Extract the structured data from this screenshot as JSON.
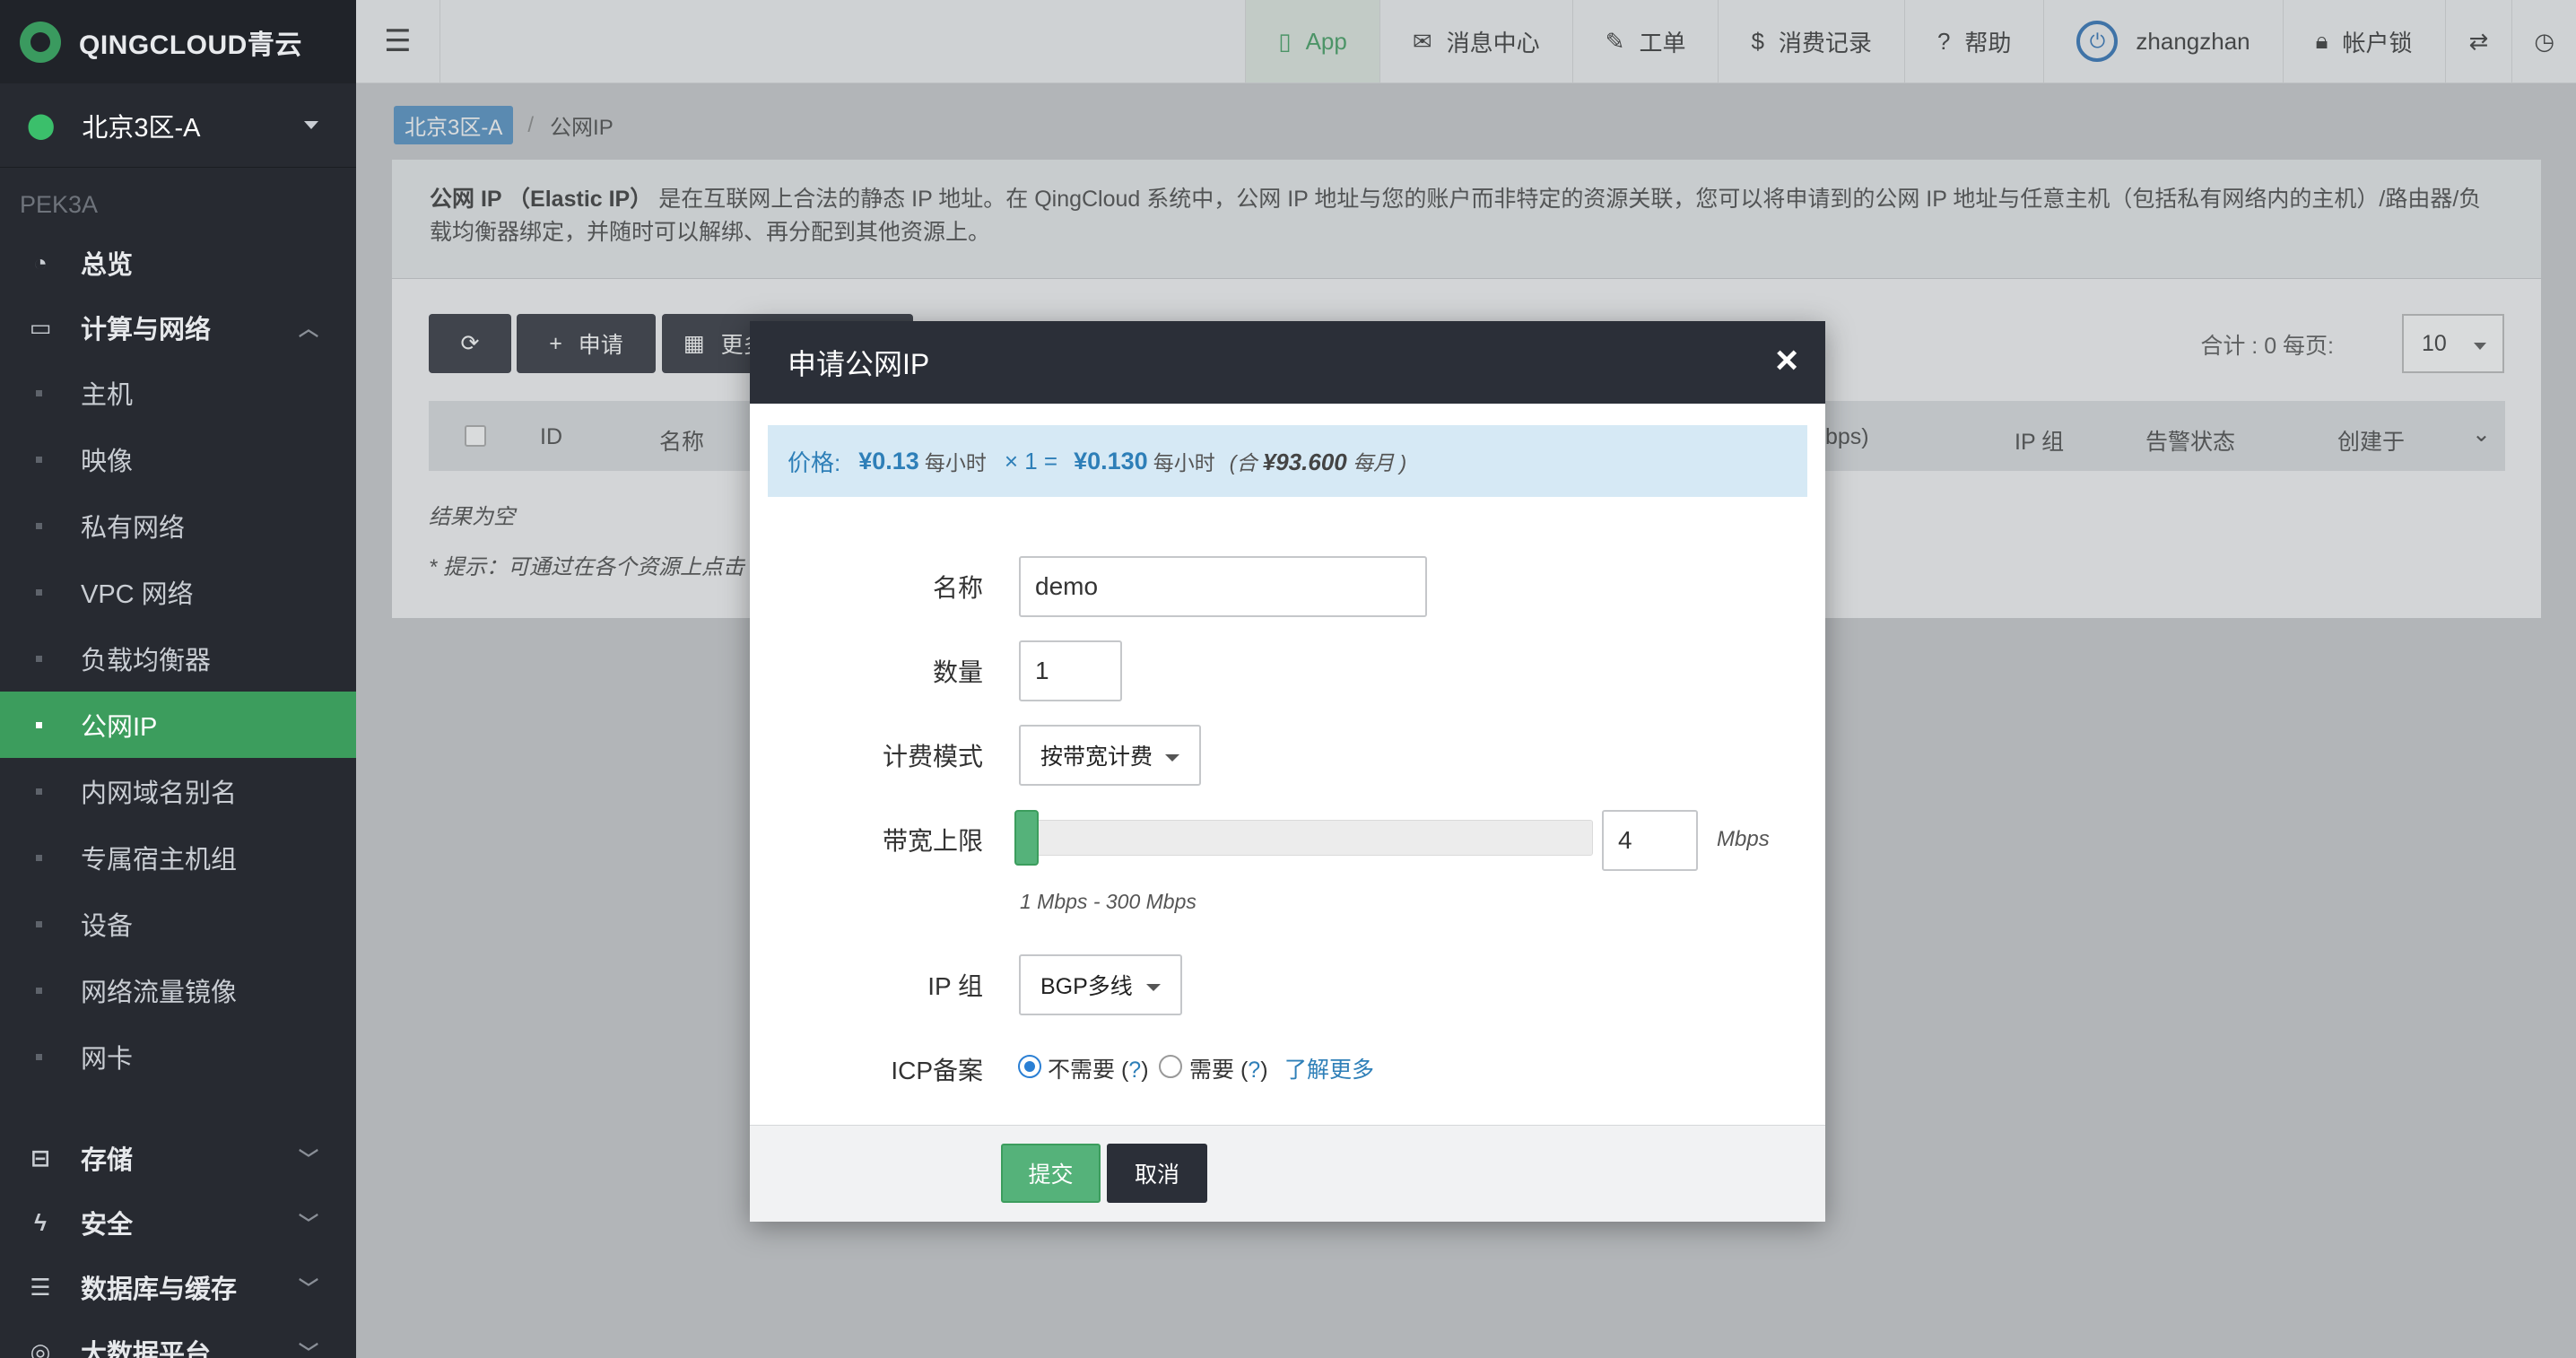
{
  "brand": {
    "logo_text": "QINGCLOUD青云"
  },
  "region": {
    "name": "北京3区-A",
    "code": "PEK3A"
  },
  "sidebar": {
    "group_overview": "总览",
    "group_compute": "计算与网络",
    "items": [
      {
        "label": "主机"
      },
      {
        "label": "映像"
      },
      {
        "label": "私有网络"
      },
      {
        "label": "VPC 网络"
      },
      {
        "label": "负载均衡器"
      },
      {
        "label": "公网IP"
      },
      {
        "label": "内网域名别名"
      },
      {
        "label": "专属宿主机组"
      },
      {
        "label": "设备"
      },
      {
        "label": "网络流量镜像"
      },
      {
        "label": "网卡"
      }
    ],
    "group_storage": "存储",
    "group_security": "安全",
    "group_database": "数据库与缓存",
    "group_bigdata": "大数据平台"
  },
  "topbar": {
    "app": "App",
    "messages": "消息中心",
    "tickets": "工单",
    "billing": "消费记录",
    "help": "帮助",
    "user": "zhangzhan",
    "lock": "帐户锁"
  },
  "breadcrumb": {
    "region": "北京3区-A",
    "sep": "/",
    "page": "公网IP"
  },
  "info": {
    "title": "公网 IP （Elastic IP）",
    "text": "是在互联网上合法的静态 IP 地址。在 QingCloud 系统中，公网 IP 地址与您的账户而非特定的资源关联，您可以将申请到的公网 IP 地址与任意主机（包括私有网络内的主机）/路由器/负载均衡器绑定，并随时可以解绑、再分配到其他资源上。"
  },
  "toolbar": {
    "apply": "申请",
    "more": "更多",
    "total": "合计 : 0  每页:",
    "per_page": "10"
  },
  "table": {
    "columns": {
      "id": "ID",
      "name": "名称",
      "bandwidth": "bps)",
      "ip_group": "IP 组",
      "alarm": "告警状态",
      "created": "创建于"
    },
    "empty": "结果为空",
    "hint": "* 提示：可通过在各个资源上点击"
  },
  "modal": {
    "title": "申请公网IP",
    "price": {
      "label": "价格:",
      "unit_price": "¥0.13",
      "per_hour": "每小时",
      "times": "× 1 =",
      "total": "¥0.130",
      "per_hour2": "每小时",
      "monthly_prefix": "(合",
      "monthly": "¥93.600",
      "monthly_suffix": "每月 )"
    },
    "fields": {
      "name_label": "名称",
      "name_value": "demo",
      "count_label": "数量",
      "count_value": "1",
      "billing_label": "计费模式",
      "billing_value": "按带宽计费",
      "bandwidth_label": "带宽上限",
      "bandwidth_value": "4",
      "bandwidth_unit": "Mbps",
      "bandwidth_range": "1 Mbps - 300 Mbps",
      "ipgroup_label": "IP 组",
      "ipgroup_value": "BGP多线",
      "icp_label": "ICP备案",
      "icp_no": "不需要 (",
      "icp_yes": "需要 (",
      "qmark": "?",
      "close_paren": ")",
      "learn_more": "了解更多"
    },
    "submit": "提交",
    "cancel": "取消"
  },
  "colors": {
    "accent_green": "#3c9d5d",
    "dark": "#2b2f38",
    "link_blue": "#2e7fb8"
  }
}
